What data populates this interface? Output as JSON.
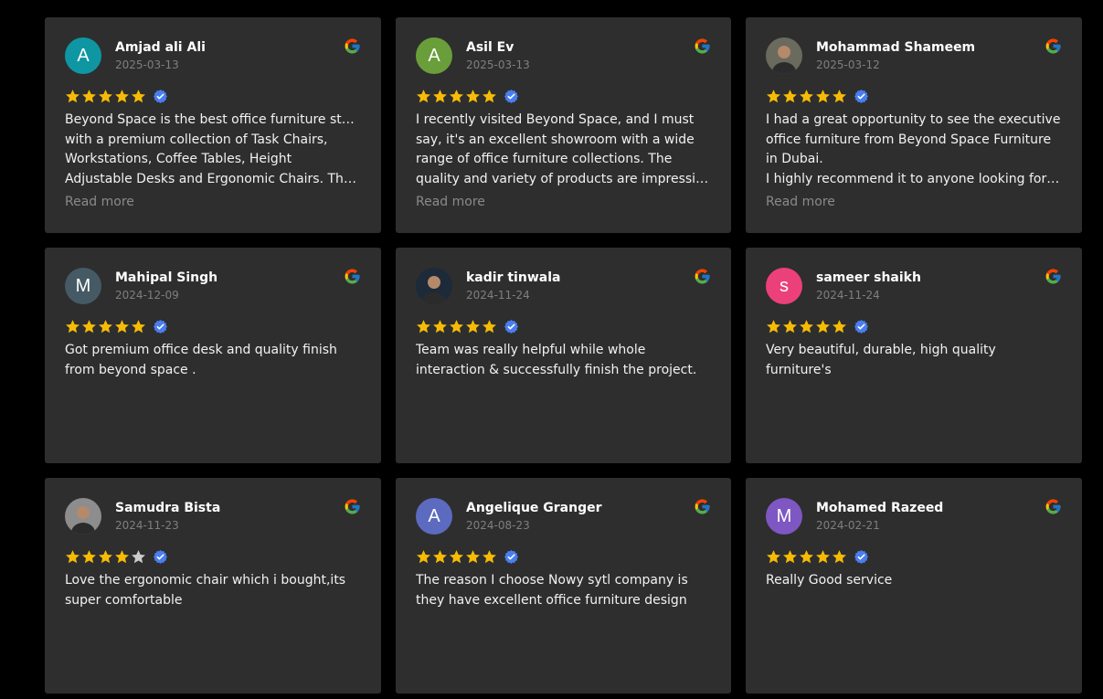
{
  "colors": {
    "background": "#000000",
    "card": "#2e2e2e",
    "star_filled": "#f6bb06",
    "star_empty": "#cccccc",
    "verified": "#4a7ef0"
  },
  "icons": {
    "platform": "google-icon",
    "verified": "verified-badge-icon",
    "star": "star-icon"
  },
  "read_more_label": "Read more",
  "reviews": [
    {
      "name": "Amjad ali Ali",
      "date": "2025-03-13",
      "rating": 5,
      "avatar": {
        "type": "initial",
        "initial": "A",
        "color": "#0f96a3"
      },
      "lines": [
        "Beyond Space is the best office furniture store",
        "with a premium collection of Task Chairs,",
        "Workstations, Coffee Tables, Height",
        "Adjustable Desks and Ergonomic Chairs. The…"
      ],
      "truncated": true
    },
    {
      "name": "Asil Ev",
      "date": "2025-03-13",
      "rating": 5,
      "avatar": {
        "type": "initial",
        "initial": "A",
        "color": "#6a9e3a"
      },
      "lines": [
        "I recently visited Beyond Space, and I must",
        "say, it's an excellent showroom with a wide",
        "range of office furniture collections. The",
        "quality and variety of products are impressiv…"
      ],
      "truncated": true
    },
    {
      "name": "Mohammad Shameem",
      "date": "2025-03-12",
      "rating": 5,
      "avatar": {
        "type": "photo",
        "color": "#6b6a5e"
      },
      "lines": [
        "I had a great opportunity to see the executive",
        "office furniture from Beyond Space Furniture",
        "in Dubai.",
        "I highly recommend it to anyone looking for…"
      ],
      "truncated": true
    },
    {
      "name": "Mahipal Singh",
      "date": "2024-12-09",
      "rating": 5,
      "avatar": {
        "type": "initial",
        "initial": "M",
        "color": "#455a64"
      },
      "lines": [
        "Got premium office desk and quality finish",
        "from beyond space ."
      ],
      "truncated": false
    },
    {
      "name": "kadir tinwala",
      "date": "2024-11-24",
      "rating": 5,
      "avatar": {
        "type": "photo",
        "color": "#1c2a3a"
      },
      "lines": [
        "Team was really helpful while whole",
        "interaction & successfully finish the project."
      ],
      "truncated": false
    },
    {
      "name": "sameer shaikh",
      "date": "2024-11-24",
      "rating": 5,
      "avatar": {
        "type": "initial",
        "initial": "s",
        "color": "#ec407a"
      },
      "lines": [
        "Very beautiful, durable, high quality",
        "furniture's"
      ],
      "truncated": false
    },
    {
      "name": "Samudra Bista",
      "date": "2024-11-23",
      "rating": 4,
      "avatar": {
        "type": "photo",
        "color": "#8d8d8d"
      },
      "lines": [
        "Love the ergonomic chair which i bought,its",
        "super comfortable"
      ],
      "truncated": false
    },
    {
      "name": "Angelique Granger",
      "date": "2024-08-23",
      "rating": 5,
      "avatar": {
        "type": "initial",
        "initial": "A",
        "color": "#5c6bc0"
      },
      "lines": [
        "The reason I choose Nowy sytl company is",
        "they have excellent office furniture design"
      ],
      "truncated": false
    },
    {
      "name": "Mohamed Razeed",
      "date": "2024-02-21",
      "rating": 5,
      "avatar": {
        "type": "initial",
        "initial": "M",
        "color": "#7e57c2"
      },
      "lines": [
        "Really Good service"
      ],
      "truncated": false
    }
  ]
}
